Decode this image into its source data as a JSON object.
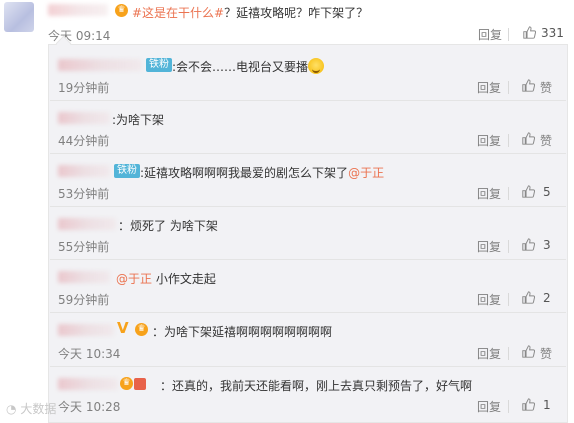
{
  "main_post": {
    "hashtag": "#这是在干什么#",
    "text": "？延禧攻略呢？咋下架了？",
    "time": "今天 09:14",
    "reply_label": "回复",
    "like_count": "331"
  },
  "replies": [
    {
      "badge": "铁粉",
      "separator": ":",
      "text": "会不会……电视台又要播",
      "time": "19分钟前",
      "reply_label": "回复",
      "like_label": "赞"
    },
    {
      "separator": ":",
      "text": "为啥下架",
      "time": "44分钟前",
      "reply_label": "回复",
      "like_label": "赞"
    },
    {
      "badge": "铁粉",
      "separator": ":",
      "text": "延禧攻略啊啊啊我最爱的剧怎么下架了",
      "mention": "@于正",
      "time": "53分钟前",
      "reply_label": "回复",
      "like_count": "5"
    },
    {
      "separator": "：",
      "text": "烦死了 为啥下架",
      "time": "55分钟前",
      "reply_label": "回复",
      "like_count": "3"
    },
    {
      "mention": "@于正",
      "text": "小作文走起",
      "time": "59分钟前",
      "reply_label": "回复",
      "like_count": "2"
    },
    {
      "separator": "：",
      "text": "为啥下架延禧啊啊啊啊啊啊啊啊",
      "time": "今天 10:34",
      "reply_label": "回复",
      "like_label": "赞"
    },
    {
      "separator": "：",
      "text": "还真的，我前天还能看啊，刚上去真只剩预告了，好气啊",
      "time": "今天 10:28",
      "reply_label": "回复",
      "like_count": "1"
    }
  ],
  "watermark": "大数据",
  "colors": {
    "accent": "#eb7350",
    "fan_badge": "#52b4d8",
    "gold": "#f7a21b",
    "reply_bg": "#f2f2f5"
  }
}
